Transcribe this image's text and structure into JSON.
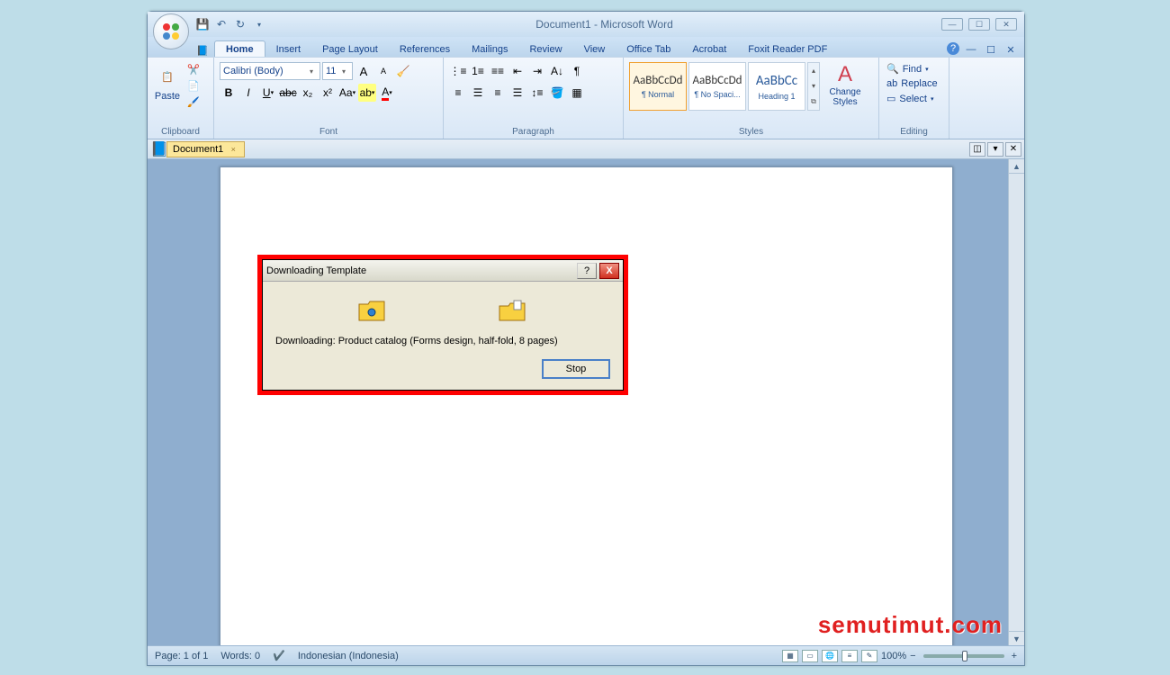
{
  "title": "Document1 - Microsoft Word",
  "qat": {
    "save": "save",
    "undo": "undo",
    "redo": "redo"
  },
  "tabs": [
    "Home",
    "Insert",
    "Page Layout",
    "References",
    "Mailings",
    "Review",
    "View",
    "Office Tab",
    "Acrobat",
    "Foxit Reader PDF"
  ],
  "activeTab": 0,
  "ribbon": {
    "clipboard": {
      "label": "Clipboard",
      "paste": "Paste"
    },
    "font": {
      "label": "Font",
      "name": "Calibri (Body)",
      "size": "11"
    },
    "paragraph": {
      "label": "Paragraph"
    },
    "styles": {
      "label": "Styles",
      "items": [
        {
          "preview": "AaBbCcDd",
          "name": "¶ Normal"
        },
        {
          "preview": "AaBbCcDd",
          "name": "¶ No Spaci..."
        },
        {
          "preview": "AaBbCc",
          "name": "Heading 1"
        }
      ],
      "change": "Change Styles"
    },
    "editing": {
      "label": "Editing",
      "find": "Find",
      "replace": "Replace",
      "select": "Select"
    }
  },
  "docTab": {
    "name": "Document1"
  },
  "status": {
    "page": "Page: 1 of 1",
    "words": "Words: 0",
    "lang": "Indonesian (Indonesia)",
    "zoom": "100%"
  },
  "dialog": {
    "title": "Downloading Template",
    "text": "Downloading: Product catalog (Forms design, half-fold, 8 pages)",
    "stop": "Stop"
  },
  "watermark": "semutimut.com"
}
